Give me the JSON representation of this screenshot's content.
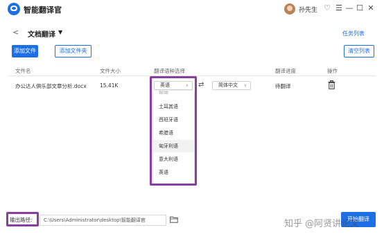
{
  "window": {
    "app_title": "智能翻译官",
    "username": "孙先生",
    "controls": {
      "skin": "♡",
      "menu": "☰",
      "minimize": "—",
      "maximize": "☐",
      "close": "✕"
    }
  },
  "toolbar": {
    "page_title": "文档翻译",
    "task_list_label": "任务列表",
    "add_file_label": "添加文件",
    "add_folder_label": "添加文件夹",
    "clear_list_label": "清空列表"
  },
  "table": {
    "headers": [
      "文件名",
      "文件大小",
      "翻译语种选择",
      "翻译进度",
      "操作"
    ],
    "rows": [
      {
        "file_name": "办公达人俱乐部文章分析.docx",
        "file_size": "15.41K",
        "source_lang": "英语",
        "target_lang": "简体中文",
        "progress": "待翻译"
      }
    ]
  },
  "language_dropdown": {
    "partial_top": "德语",
    "items": [
      "土耳其语",
      "西班牙语",
      "希腊语",
      "匈牙利语",
      "意大利语",
      "英语"
    ],
    "highlighted_index": 3
  },
  "bottom": {
    "output_label": "输出路径:",
    "output_path": "C:\\Users\\Administrator\\desktop\\智能翻译官",
    "start_label": "开始翻译"
  },
  "watermark": "知乎 @阿贤讲论文",
  "colors": {
    "accent": "#1e6fe6",
    "annotation": "#8a3fa0"
  }
}
